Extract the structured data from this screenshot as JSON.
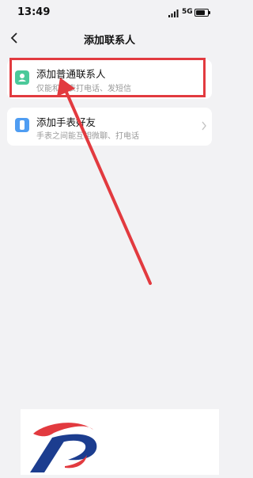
{
  "status_bar": {
    "time": "13:49",
    "network": "5G"
  },
  "nav": {
    "title": "添加联系人"
  },
  "cards": [
    {
      "title": "添加普通联系人",
      "subtitle": "仅能和手表打电话、发短信"
    },
    {
      "title": "添加手表好友",
      "subtitle": "手表之间能互相微聊、打电话"
    }
  ],
  "colors": {
    "highlight": "#e23a3f",
    "card1_icon": "#4bc99a",
    "card2_icon": "#4f9df2"
  },
  "icons": [
    "signal-icon",
    "battery-icon",
    "back-icon",
    "contact-icon",
    "watch-icon",
    "chevron-right-icon",
    "annotation-arrow",
    "watermark-logo"
  ]
}
